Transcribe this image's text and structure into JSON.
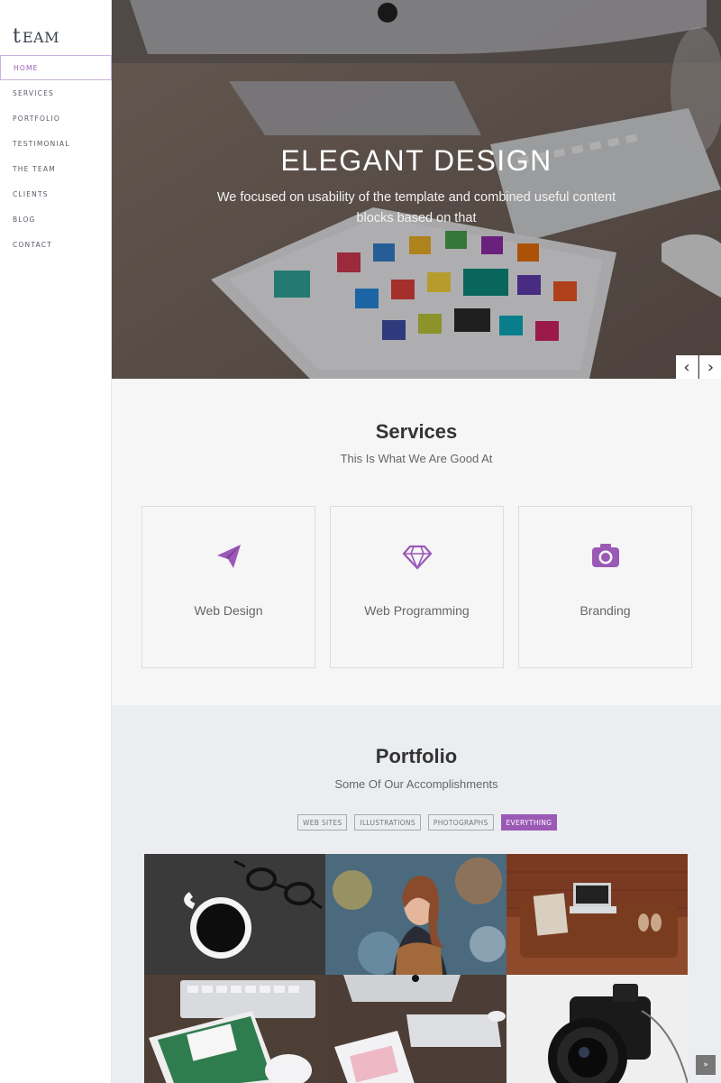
{
  "brand": {
    "logo_mark": "t",
    "logo_word": "EAM"
  },
  "nav": {
    "items": [
      {
        "label": "HOME",
        "active": true
      },
      {
        "label": "SERVICES",
        "active": false
      },
      {
        "label": "PORTFOLIO",
        "active": false
      },
      {
        "label": "TESTIMONIAL",
        "active": false
      },
      {
        "label": "THE TEAM",
        "active": false
      },
      {
        "label": "CLIENTS",
        "active": false
      },
      {
        "label": "BLOG",
        "active": false
      },
      {
        "label": "CONTACT",
        "active": false
      }
    ]
  },
  "hero": {
    "title": "ELEGANT DESIGN",
    "subtitle": "We focused on usability of the template and combined useful content blocks based on that",
    "prev_icon": "chevron-left-icon",
    "next_icon": "chevron-right-icon",
    "prev_glyph": "‹",
    "next_glyph": "›"
  },
  "services": {
    "title": "Services",
    "subtitle": "This Is What We Are Good At",
    "items": [
      {
        "label": "Web Design",
        "icon": "paper-plane-icon"
      },
      {
        "label": "Web Programming",
        "icon": "diamond-icon"
      },
      {
        "label": "Branding",
        "icon": "camera-icon"
      }
    ]
  },
  "portfolio": {
    "title": "Portfolio",
    "subtitle": "Some Of Our Accomplishments",
    "filters": [
      {
        "label": "WEB SITES",
        "active": false
      },
      {
        "label": "ILLUSTRATIONS",
        "active": false
      },
      {
        "label": "PHOTOGRAPHS",
        "active": false
      },
      {
        "label": "EVERYTHING",
        "active": true
      }
    ]
  },
  "back_to_top": {
    "glyph": "»",
    "icon": "double-chevron-up-icon"
  },
  "colors": {
    "accent": "#9b59b6",
    "sidebar_text": "#555b66",
    "services_bg": "#f6f6f7",
    "portfolio_bg": "#ebedf0"
  }
}
